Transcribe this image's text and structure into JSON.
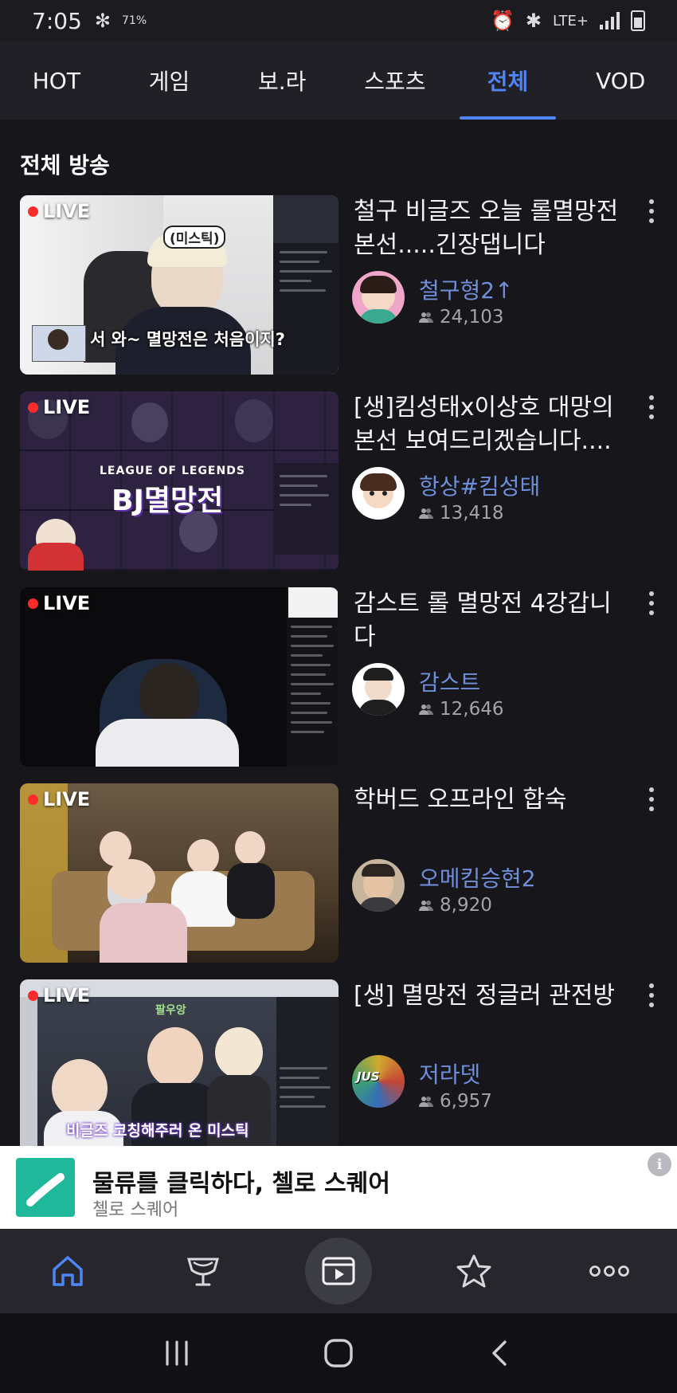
{
  "status_bar": {
    "time": "7:05",
    "battery_small": "71%",
    "network": "LTE+"
  },
  "tabs": [
    {
      "label": "HOT",
      "active": false
    },
    {
      "label": "게임",
      "active": false
    },
    {
      "label": "보.라",
      "active": false
    },
    {
      "label": "스포츠",
      "active": false
    },
    {
      "label": "전체",
      "active": true
    },
    {
      "label": "VOD",
      "active": false
    }
  ],
  "section": {
    "title": "전체 방송"
  },
  "live_label": "LIVE",
  "streams": [
    {
      "title": "철구 비글즈 오늘 롤멸망전 본선.....긴장댑니다",
      "streamer": "철구형2↑",
      "viewers": "24,103",
      "thumb_caption": "서 와~ 멸망전은 처음이지?",
      "thumb_tag": "(미스틱)"
    },
    {
      "title": "[생]킴성태x이상호 대망의 본선 보여드리겠습니다....",
      "streamer": "항상#킴성태",
      "viewers": "13,418",
      "thumb_caption": "BJ멸망전",
      "thumb_tag": "LEAGUE OF LEGENDS"
    },
    {
      "title": "감스트 롤 멸망전 4강갑니다",
      "streamer": "감스트",
      "viewers": "12,646",
      "thumb_caption": "",
      "thumb_tag": ""
    },
    {
      "title": "학버드 오프라인 합숙",
      "streamer": "오메킴승현2",
      "viewers": "8,920",
      "thumb_caption": "",
      "thumb_tag": ""
    },
    {
      "title": "[생] 멸망전 정글러 관전방",
      "streamer": "저라뎃",
      "viewers": "6,957",
      "thumb_caption": "비글즈 코칭해주러 온 미스틱",
      "thumb_tag": "팔우앙"
    }
  ],
  "ad": {
    "title": "물류를 클릭하다, 첼로 스퀘어",
    "subtitle": "첼로 스퀘어",
    "info": "i",
    "brand_color": "#1fb89b"
  },
  "bottom_nav": [
    {
      "icon": "home-icon",
      "active": true
    },
    {
      "icon": "trophy-icon",
      "active": false
    },
    {
      "icon": "play-video-icon",
      "active": false
    },
    {
      "icon": "star-icon",
      "active": false
    },
    {
      "icon": "more-icon",
      "active": false
    }
  ],
  "colors": {
    "accent": "#4f86f7",
    "streamer_name": "#6f8fdb",
    "live_dot": "#ff2a2a",
    "background": "#17171b"
  }
}
